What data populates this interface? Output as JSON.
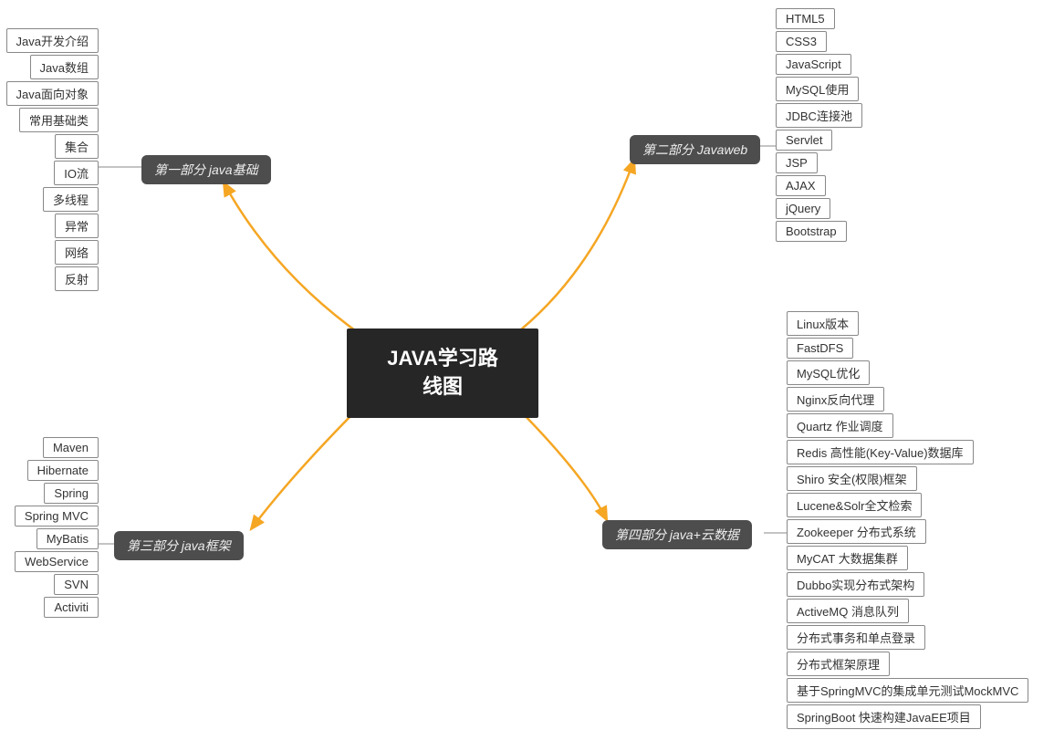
{
  "center": {
    "title_line1": "JAVA学习路",
    "title_line2": "线图"
  },
  "branches": {
    "part1": {
      "label": "第一部分 java基础",
      "leaves": [
        "Java开发介绍",
        "Java数组",
        "Java面向对象",
        "常用基础类",
        "集合",
        "IO流",
        "多线程",
        "异常",
        "网络",
        "反射"
      ]
    },
    "part2": {
      "label": "第二部分 Javaweb",
      "leaves": [
        "HTML5",
        "CSS3",
        "JavaScript",
        "MySQL使用",
        "JDBC连接池",
        "Servlet",
        "JSP",
        "AJAX",
        "jQuery",
        "Bootstrap"
      ]
    },
    "part3": {
      "label": "第三部分 java框架",
      "leaves": [
        "Maven",
        "Hibernate",
        "Spring",
        "Spring MVC",
        "MyBatis",
        "WebService",
        "SVN",
        "Activiti"
      ]
    },
    "part4": {
      "label": "第四部分 java+云数据",
      "leaves": [
        "Linux版本",
        "FastDFS",
        "MySQL优化",
        "Nginx反向代理",
        "Quartz 作业调度",
        "Redis 高性能(Key-Value)数据库",
        "Shiro 安全(权限)框架",
        "Lucene&Solr全文检索",
        "Zookeeper 分布式系统",
        "MyCAT 大数据集群",
        "Dubbo实现分布式架构",
        "ActiveMQ 消息队列",
        "分布式事务和单点登录",
        "分布式框架原理",
        "基于SpringMVC的集成单元测试MockMVC",
        "SpringBoot 快速构建JavaEE项目"
      ]
    }
  }
}
